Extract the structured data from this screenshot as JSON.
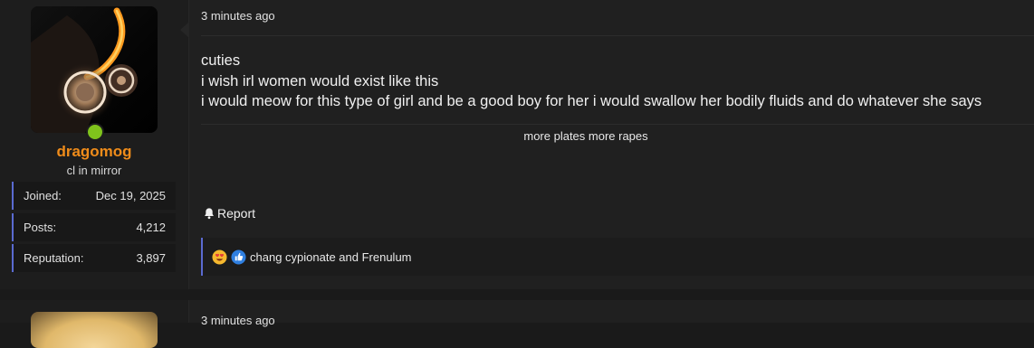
{
  "post": {
    "user": {
      "username": "dragomog",
      "user_title": "cl in mirror",
      "online": true,
      "stats": [
        {
          "label": "Joined:",
          "value": "Dec 19, 2025"
        },
        {
          "label": "Posts:",
          "value": "4,212"
        },
        {
          "label": "Reputation:",
          "value": "3,897"
        }
      ],
      "colors": {
        "username": "#f08c1a",
        "online": "#7fc31c",
        "accent": "#5a6ad0"
      }
    },
    "time": "3 minutes ago",
    "body_lines": [
      "cuties",
      "i wish irl women would exist like this",
      "i would meow for this type of girl and be a good boy for her i would swallow her bodily fluids and do whatever she says"
    ],
    "signature": "more plates more rapes",
    "report_label": "Report",
    "reactions": {
      "icons": [
        "heart-eyes-emoji-icon",
        "thumbs-up-icon"
      ],
      "text": "chang cypionate and Frenulum"
    }
  },
  "next_post": {
    "time": "3 minutes ago"
  }
}
